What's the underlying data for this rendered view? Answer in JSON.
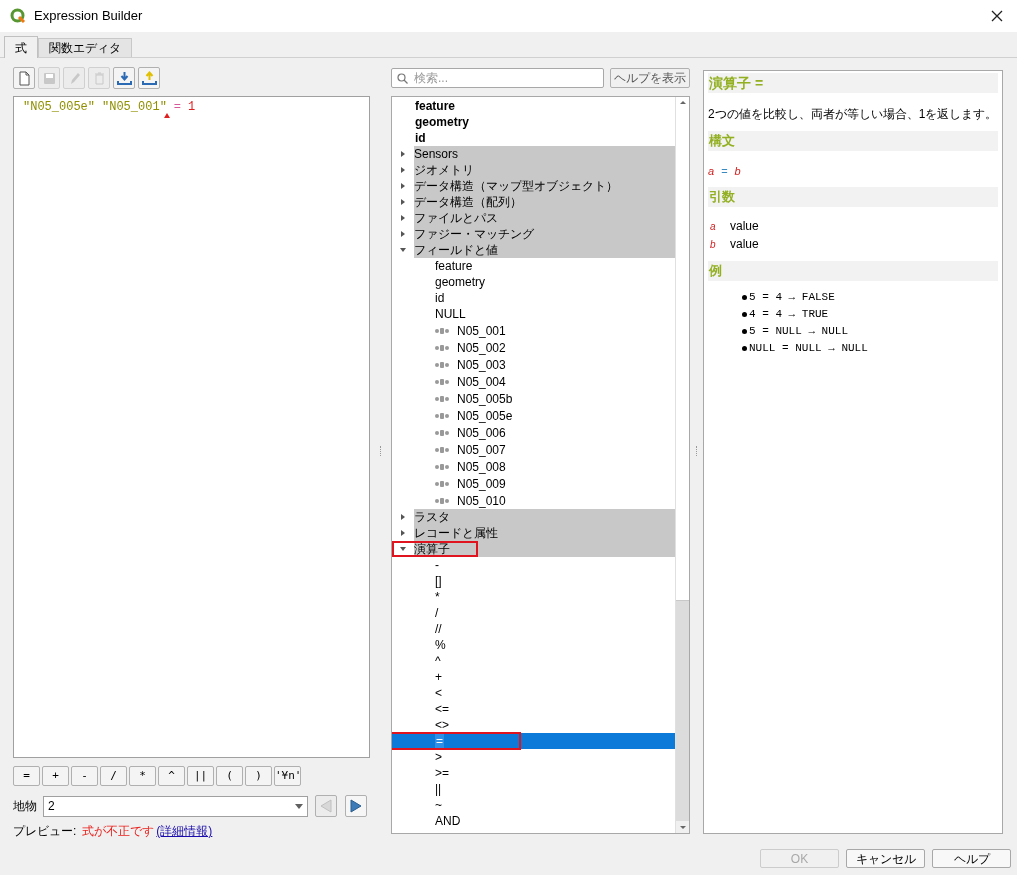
{
  "window": {
    "title": "Expression Builder"
  },
  "tabs": [
    {
      "label": "式",
      "selected": true
    },
    {
      "label": "関数エディタ",
      "selected": false
    }
  ],
  "toolbar": [
    {
      "kind": "new",
      "disabled": false
    },
    {
      "kind": "save",
      "disabled": true
    },
    {
      "kind": "edit",
      "disabled": true
    },
    {
      "kind": "delete",
      "disabled": true
    },
    {
      "kind": "import",
      "disabled": false
    },
    {
      "kind": "export",
      "disabled": false
    }
  ],
  "editor": {
    "tokens": [
      {
        "kind": "string",
        "text": "\"N05_005e\"",
        "error": false
      },
      {
        "kind": "string",
        "text": "\"N05_001\"",
        "error": true
      },
      {
        "kind": "operator",
        "text": "=",
        "error": false
      },
      {
        "kind": "number",
        "text": "1",
        "error": false
      }
    ]
  },
  "operator_buttons": [
    "=",
    "+",
    "-",
    "/",
    "*",
    "^",
    "||",
    "(",
    ")",
    "'¥n'"
  ],
  "feature": {
    "label": "地物",
    "value": "2",
    "previous_disabled": true,
    "next_disabled": false
  },
  "preview": {
    "label": "プレビュー:",
    "message": "式が不正です",
    "link": "(詳細情報)"
  },
  "search": {
    "placeholder": "検索...",
    "help_button": "ヘルプを表示"
  },
  "tree": [
    {
      "label": "feature",
      "kind": "variable"
    },
    {
      "label": "geometry",
      "kind": "variable"
    },
    {
      "label": "id",
      "kind": "variable"
    },
    {
      "label": "Sensors",
      "kind": "group",
      "expanded": false
    },
    {
      "label": "ジオメトリ",
      "kind": "group",
      "expanded": false
    },
    {
      "label": "データ構造（マップ型オブジェクト）",
      "kind": "group",
      "expanded": false
    },
    {
      "label": "データ構造（配列）",
      "kind": "group",
      "expanded": false
    },
    {
      "label": "ファイルとパス",
      "kind": "group",
      "expanded": false
    },
    {
      "label": "ファジー・マッチング",
      "kind": "group",
      "expanded": false
    },
    {
      "label": "フィールドと値",
      "kind": "group",
      "expanded": true,
      "children": [
        {
          "label": "feature",
          "kind": "item"
        },
        {
          "label": "geometry",
          "kind": "item"
        },
        {
          "label": "id",
          "kind": "item"
        },
        {
          "label": "NULL",
          "kind": "item"
        },
        {
          "label": "N05_001",
          "kind": "field"
        },
        {
          "label": "N05_002",
          "kind": "field"
        },
        {
          "label": "N05_003",
          "kind": "field"
        },
        {
          "label": "N05_004",
          "kind": "field"
        },
        {
          "label": "N05_005b",
          "kind": "field"
        },
        {
          "label": "N05_005e",
          "kind": "field"
        },
        {
          "label": "N05_006",
          "kind": "field"
        },
        {
          "label": "N05_007",
          "kind": "field"
        },
        {
          "label": "N05_008",
          "kind": "field"
        },
        {
          "label": "N05_009",
          "kind": "field"
        },
        {
          "label": "N05_010",
          "kind": "field"
        }
      ]
    },
    {
      "label": "ラスタ",
      "kind": "group",
      "expanded": false
    },
    {
      "label": "レコードと属性",
      "kind": "group",
      "expanded": false
    },
    {
      "label": "演算子",
      "kind": "group",
      "expanded": true,
      "annotated": true,
      "children": [
        {
          "label": "-",
          "kind": "item",
          "selected": false
        },
        {
          "label": "[]",
          "kind": "item",
          "selected": false
        },
        {
          "label": "*",
          "kind": "item",
          "selected": false
        },
        {
          "label": "/",
          "kind": "item",
          "selected": false
        },
        {
          "label": "//",
          "kind": "item",
          "selected": false
        },
        {
          "label": "%",
          "kind": "item",
          "selected": false
        },
        {
          "label": "^",
          "kind": "item",
          "selected": false
        },
        {
          "label": "+",
          "kind": "item",
          "selected": false
        },
        {
          "label": "<",
          "kind": "item",
          "selected": false
        },
        {
          "label": "<=",
          "kind": "item",
          "selected": false
        },
        {
          "label": "<>",
          "kind": "item",
          "selected": false
        },
        {
          "label": "=",
          "kind": "item",
          "selected": true,
          "annotated": true
        },
        {
          "label": ">",
          "kind": "item",
          "selected": false
        },
        {
          "label": ">=",
          "kind": "item",
          "selected": false
        },
        {
          "label": "||",
          "kind": "item",
          "selected": false
        },
        {
          "label": "~",
          "kind": "item",
          "selected": false
        },
        {
          "label": "AND",
          "kind": "item",
          "selected": false
        }
      ]
    }
  ],
  "help": {
    "title": "演算子 =",
    "description": "2つの値を比較し、両者が等しい場合、1を返します。",
    "syntax_heading": "構文",
    "syntax": [
      {
        "kind": "argument",
        "text": "a"
      },
      {
        "kind": "operator",
        "text": "="
      },
      {
        "kind": "argument",
        "text": "b"
      }
    ],
    "arguments_heading": "引数",
    "arguments": [
      {
        "name": "a",
        "description": "value"
      },
      {
        "name": "b",
        "description": "value"
      }
    ],
    "examples_heading": "例",
    "examples": [
      "5 = 4 → FALSE",
      "4 = 4 → TRUE",
      "5 = NULL → NULL",
      "NULL = NULL → NULL"
    ]
  },
  "buttons": [
    {
      "label": "OK",
      "disabled": true
    },
    {
      "label": "キャンセル",
      "disabled": false
    },
    {
      "label": "ヘルプ",
      "disabled": false
    }
  ]
}
